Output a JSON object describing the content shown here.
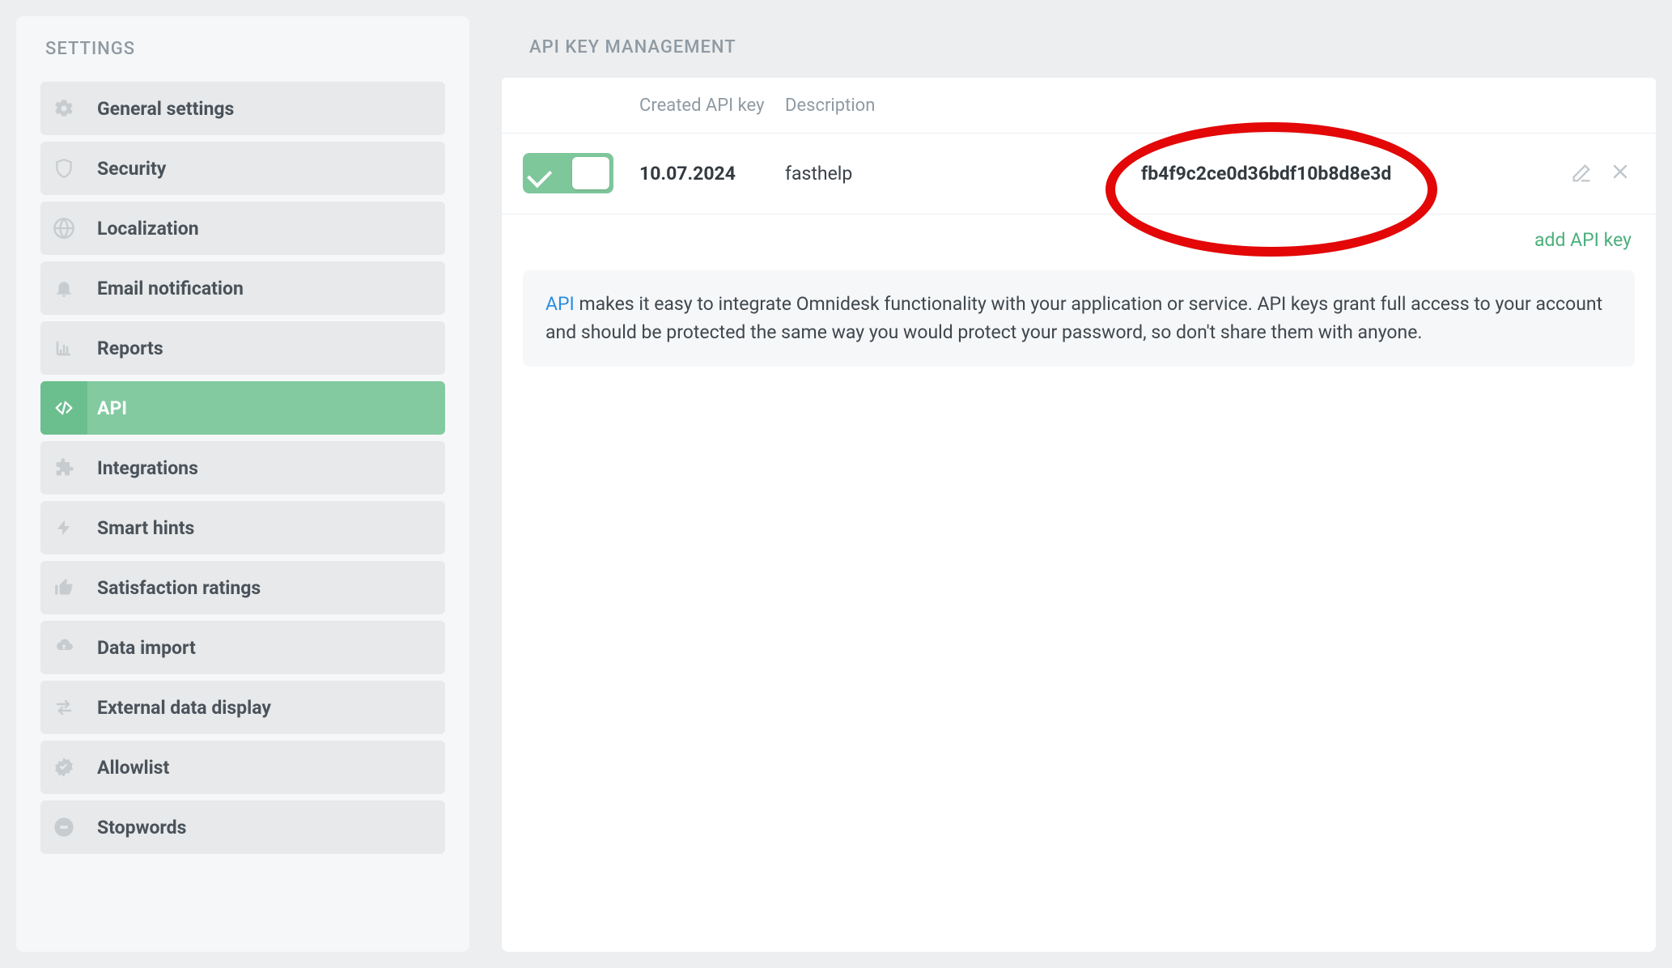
{
  "sidebar": {
    "title": "SETTINGS",
    "items": [
      {
        "label": "General settings",
        "icon": "gears"
      },
      {
        "label": "Security",
        "icon": "shield"
      },
      {
        "label": "Localization",
        "icon": "globe"
      },
      {
        "label": "Email notification",
        "icon": "bell"
      },
      {
        "label": "Reports",
        "icon": "chart"
      },
      {
        "label": "API",
        "icon": "code",
        "active": true
      },
      {
        "label": "Integrations",
        "icon": "puzzle"
      },
      {
        "label": "Smart hints",
        "icon": "bolt"
      },
      {
        "label": "Satisfaction ratings",
        "icon": "thumb"
      },
      {
        "label": "Data import",
        "icon": "cloud"
      },
      {
        "label": "External data display",
        "icon": "swap"
      },
      {
        "label": "Allowlist",
        "icon": "badge"
      },
      {
        "label": "Stopwords",
        "icon": "stop"
      }
    ]
  },
  "main": {
    "title": "API KEY MANAGEMENT",
    "columns": {
      "created": "Created API key",
      "description": "Description"
    },
    "rows": [
      {
        "created": "10.07.2024",
        "description": "fasthelp",
        "key": "fb4f9c2ce0d36bdf10b8d8e3d",
        "enabled": true
      }
    ],
    "add_link": "add API key",
    "info": {
      "link_text": "API",
      "body": " makes it easy to integrate Omnidesk functionality with your application or service. API keys grant full access to your account and should be protected the same way you would protect your password, so don't share them with anyone."
    }
  }
}
